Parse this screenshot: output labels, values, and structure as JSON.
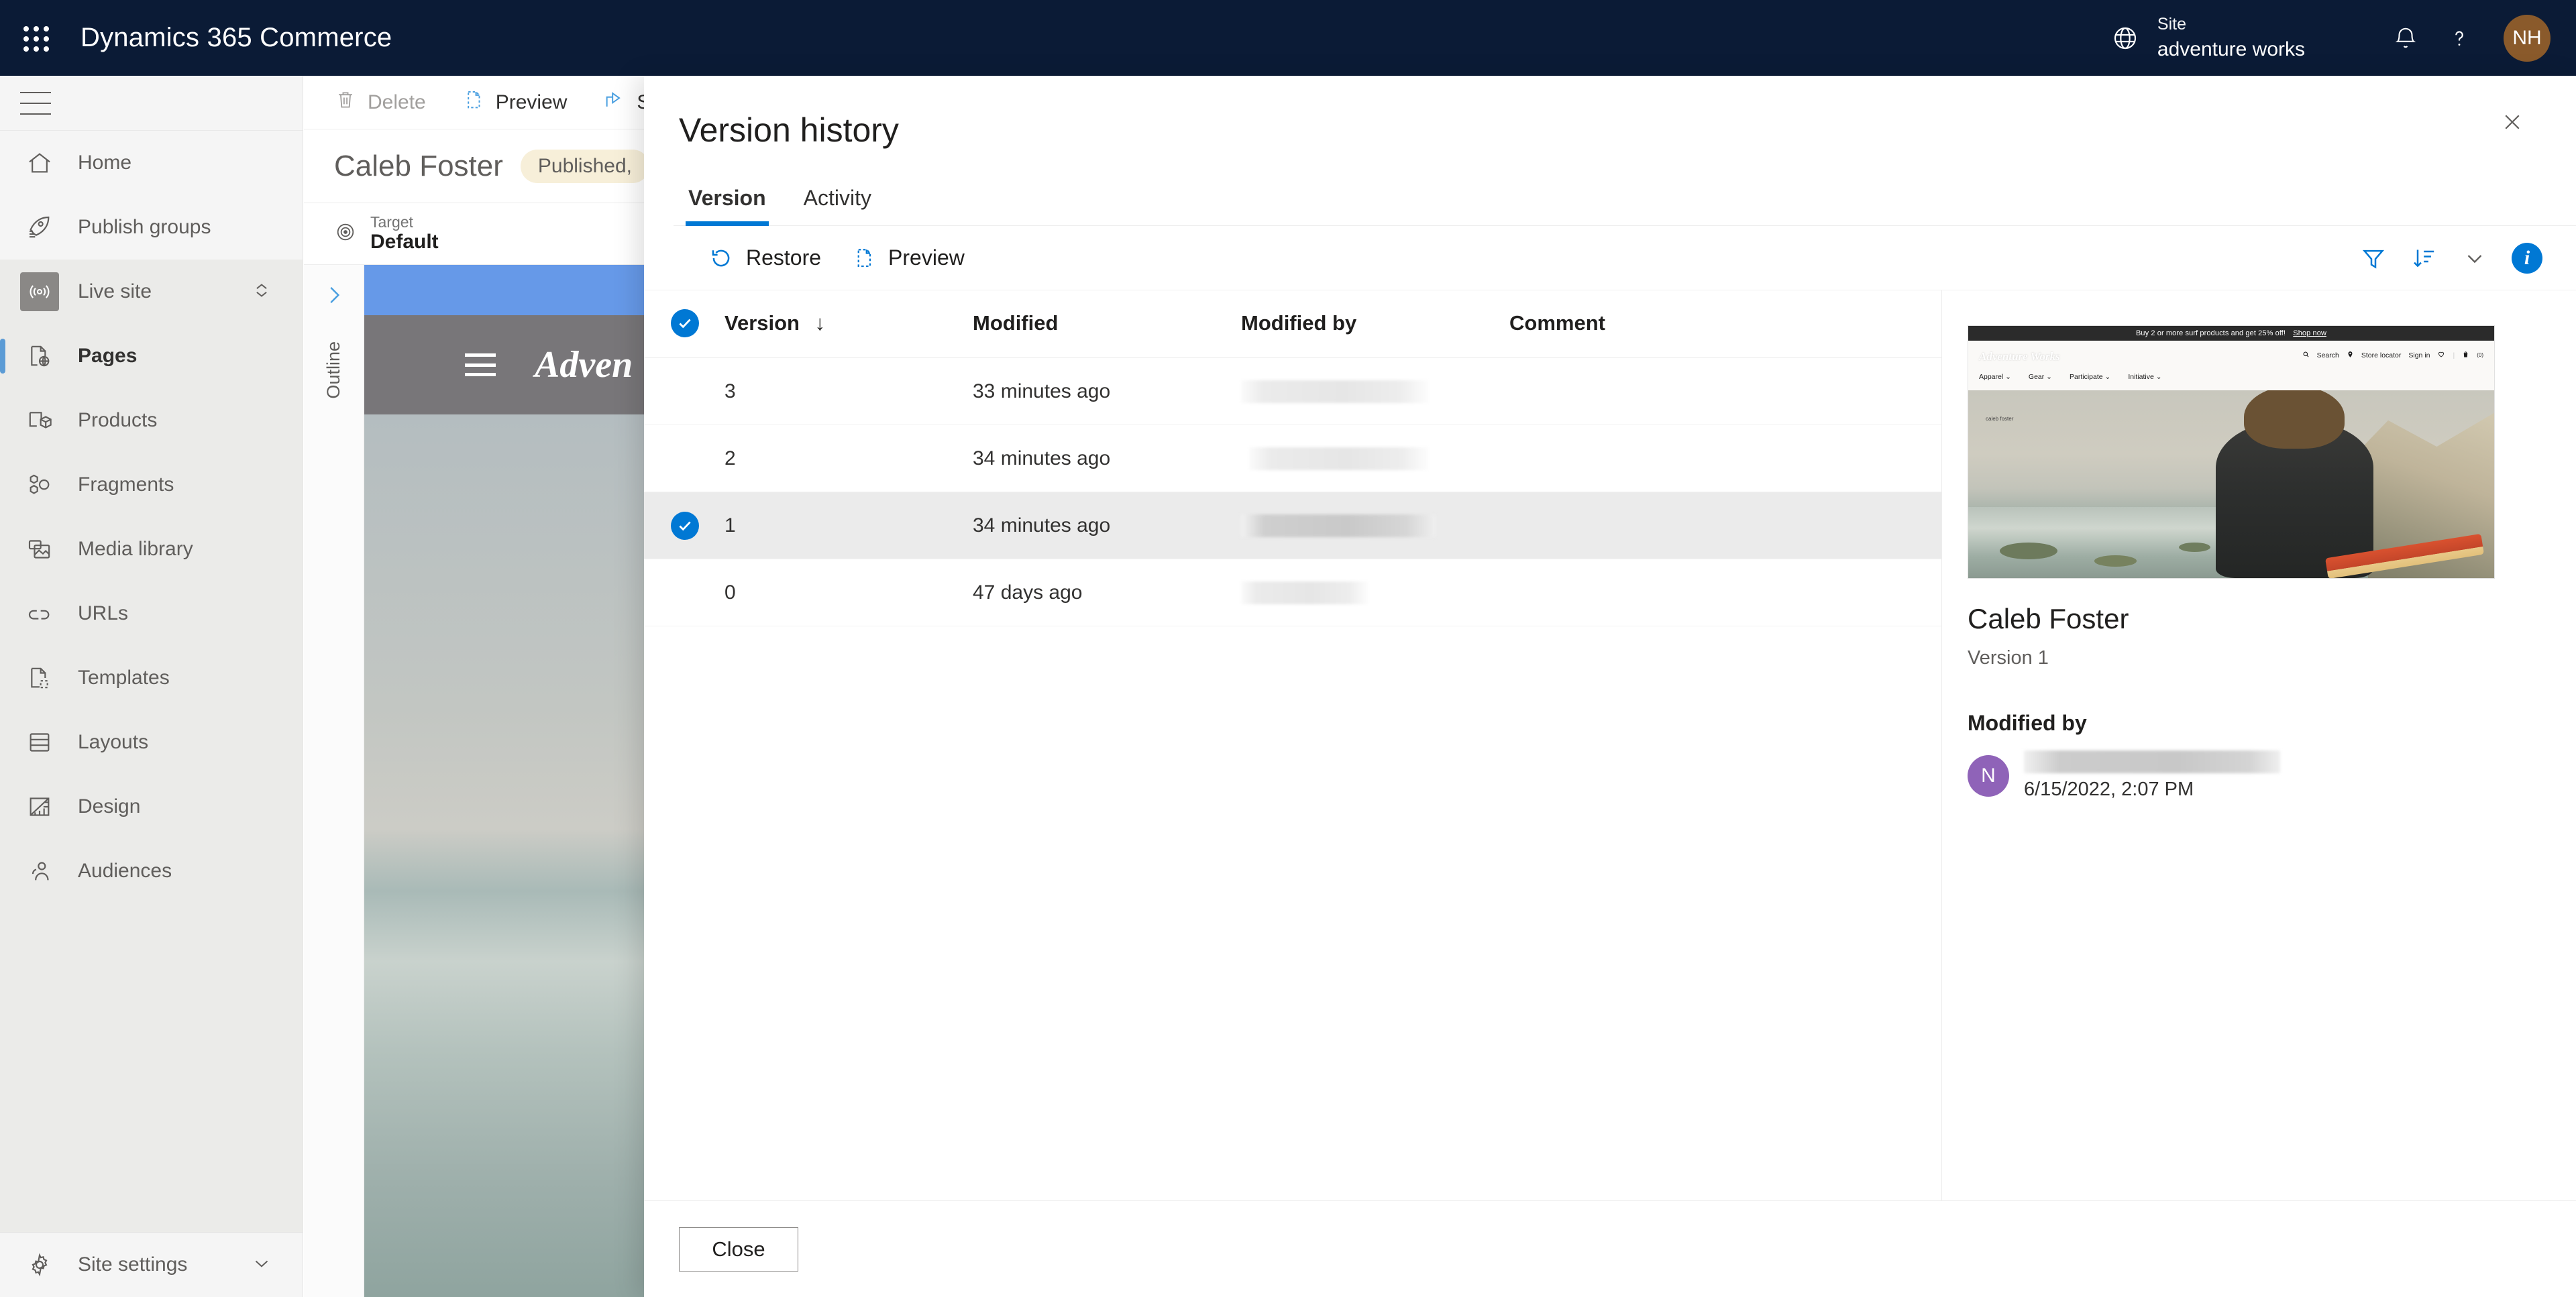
{
  "topbar": {
    "app_title": "Dynamics 365 Commerce",
    "waffle_icon": "waffle-grid-icon",
    "globe_icon": "globe-icon",
    "site_label": "Site",
    "site_name": "adventure works",
    "bell_icon": "notification-bell-icon",
    "help_icon": "help-question-icon",
    "avatar_initials": "NH",
    "avatar_color": "#8a5a2b",
    "background_color": "#0b1b36"
  },
  "sidebar": {
    "hamburger_icon": "hamburger-menu-icon",
    "top_items": [
      {
        "label": "Home",
        "icon": "home-icon"
      },
      {
        "label": "Publish groups",
        "icon": "rocket-list-icon"
      }
    ],
    "mid_items": [
      {
        "label": "Live site",
        "icon": "broadcast-icon",
        "chevron": "expand-collapse-chevron-icon"
      },
      {
        "label": "Pages",
        "icon": "page-globe-icon",
        "selected": true
      },
      {
        "label": "Products",
        "icon": "product-box-icon"
      },
      {
        "label": "Fragments",
        "icon": "fragments-icon"
      },
      {
        "label": "Media library",
        "icon": "media-image-icon"
      },
      {
        "label": "URLs",
        "icon": "link-icon"
      },
      {
        "label": "Templates",
        "icon": "template-document-icon"
      },
      {
        "label": "Layouts",
        "icon": "layout-icon"
      },
      {
        "label": "Design",
        "icon": "design-ruler-icon"
      },
      {
        "label": "Audiences",
        "icon": "people-icon"
      }
    ],
    "bottom_item": {
      "label": "Site settings",
      "icon": "gear-icon",
      "chevron": "chevron-down-icon"
    },
    "selected_accent": "#5b9bd5"
  },
  "editor": {
    "toolbar": [
      {
        "label": "Delete",
        "icon": "trash-icon",
        "disabled": true
      },
      {
        "label": "Preview",
        "icon": "preview-document-icon",
        "disabled": false
      },
      {
        "label": "S",
        "icon": "share-icon",
        "disabled": false
      }
    ],
    "page_title": "Caleb Foster",
    "status_badge": "Published,",
    "status_badge_color": "#f7efd9",
    "target_label": "Target",
    "target_value": "Default",
    "target_icon": "target-icon",
    "outline_label": "Outline",
    "outline_chevron": "chevron-right-icon",
    "canvas_logo": "Adven",
    "canvas_hamburger_icon": "hamburger-menu-icon"
  },
  "modal": {
    "title": "Version history",
    "close_icon": "close-x-icon",
    "tabs": [
      {
        "label": "Version",
        "active": true
      },
      {
        "label": "Activity",
        "active": false
      }
    ],
    "commands": [
      {
        "label": "Restore",
        "icon": "restore-undo-icon"
      },
      {
        "label": "Preview",
        "icon": "preview-document-icon"
      }
    ],
    "right_icons": [
      {
        "name": "filter-funnel-icon"
      },
      {
        "name": "sort-icon"
      },
      {
        "name": "chevron-down-icon"
      },
      {
        "name": "info-circle-icon"
      }
    ],
    "accent_color": "#0078d4",
    "table": {
      "columns": [
        "Version",
        "Modified",
        "Modified by",
        "Comment"
      ],
      "sort_indicator": "↓",
      "select_all_checked": true,
      "rows": [
        {
          "version": "3",
          "modified": "33 minutes ago",
          "modified_by_redacted_width": 280,
          "comment": "",
          "selected": false
        },
        {
          "version": "2",
          "modified": "34 minutes ago",
          "modified_by_redacted_width": 268,
          "comment": "",
          "selected": false
        },
        {
          "version": "1",
          "modified": "34 minutes ago",
          "modified_by_redacted_width": 290,
          "comment": "",
          "selected": true
        },
        {
          "version": "0",
          "modified": "47 days ago",
          "modified_by_redacted_width": 190,
          "comment": "",
          "selected": false
        }
      ]
    },
    "detail": {
      "title": "Caleb Foster",
      "version_label": "Version 1",
      "modified_by_label": "Modified by",
      "avatar_initial": "N",
      "avatar_color": "#8f63b8",
      "date": "6/15/2022, 2:07 PM",
      "thumbnail": {
        "promo_text": "Buy 2 or more surf products and get 25% off!",
        "promo_link": "Shop now",
        "logo": "Adventure Works",
        "nav_right": [
          "Search",
          "Store locator",
          "Sign in"
        ],
        "wishlist_icon": "heart-icon",
        "cart_icon": "shopping-bag-icon",
        "cart_count": "(0)",
        "search_icon": "search-icon",
        "location_icon": "location-pin-icon",
        "menu": [
          "Apparel",
          "Gear",
          "Participate",
          "Initiative"
        ],
        "hero_caption": "caleb foster"
      }
    },
    "footer": {
      "close_label": "Close"
    }
  }
}
